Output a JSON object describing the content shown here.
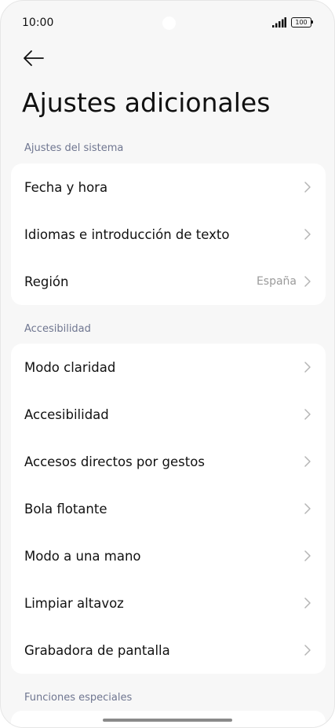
{
  "status_bar": {
    "time": "10:00",
    "battery": "100"
  },
  "page": {
    "title": "Ajustes adicionales"
  },
  "sections": [
    {
      "header": "Ajustes del sistema",
      "items": [
        {
          "label": "Fecha y hora",
          "value": ""
        },
        {
          "label": "Idiomas e introducción de texto",
          "value": ""
        },
        {
          "label": "Región",
          "value": "España"
        }
      ]
    },
    {
      "header": "Accesibilidad",
      "items": [
        {
          "label": "Modo claridad",
          "value": ""
        },
        {
          "label": "Accesibilidad",
          "value": ""
        },
        {
          "label": "Accesos directos por gestos",
          "value": ""
        },
        {
          "label": "Bola flotante",
          "value": ""
        },
        {
          "label": "Modo a una mano",
          "value": ""
        },
        {
          "label": "Limpiar altavoz",
          "value": ""
        },
        {
          "label": "Grabadora de pantalla",
          "value": ""
        }
      ]
    },
    {
      "header": "Funciones especiales",
      "items": []
    }
  ],
  "icons": {
    "back": "arrow-left-icon",
    "chevron": "chevron-right-icon",
    "signal": "signal-icon",
    "battery": "battery-icon"
  },
  "colors": {
    "background": "#f7f7f7",
    "card": "#ffffff",
    "section_header": "#6f7690",
    "secondary_text": "#9a9a9a"
  }
}
